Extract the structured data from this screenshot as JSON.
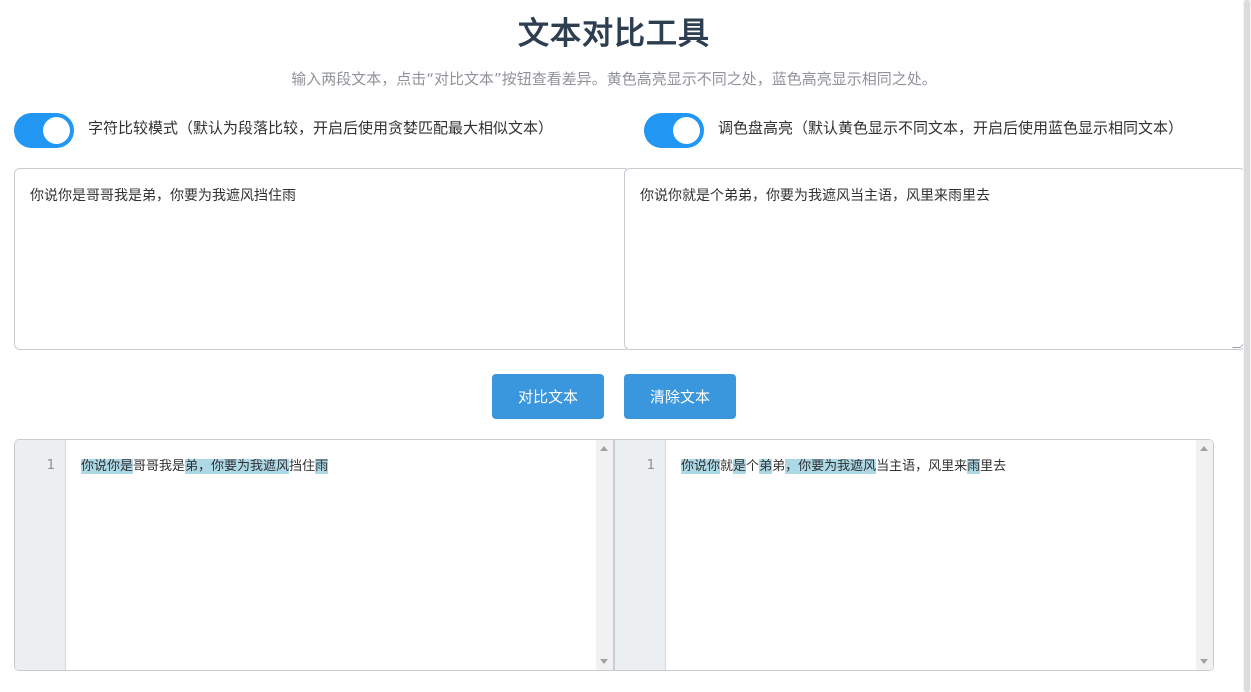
{
  "header": {
    "title": "文本对比工具",
    "subtitle": "输入两段文本，点击“对比文本”按钮查看差异。黄色高亮显示不同之处，蓝色高亮显示相同之处。"
  },
  "toggles": {
    "char_mode": {
      "label": "字符比较模式（默认为段落比较，开启后使用贪婪匹配最大相似文本）",
      "on": true
    },
    "palette": {
      "label": "调色盘高亮（默认黄色显示不同文本，开启后使用蓝色显示相同文本）",
      "on": true
    }
  },
  "inputs": {
    "left_text": "你说你是哥哥我是弟，你要为我遮风挡住雨",
    "right_text": "你说你就是个弟弟，你要为我遮风当主语，风里来雨里去"
  },
  "buttons": {
    "compare": "对比文本",
    "clear": "清除文本"
  },
  "diff": {
    "left": {
      "line_number": "1",
      "segments": [
        {
          "text": "你说你是",
          "same": true
        },
        {
          "text": "哥哥我是",
          "same": false
        },
        {
          "text": "弟，你要为我遮风",
          "same": true
        },
        {
          "text": "挡住",
          "same": false
        },
        {
          "text": "雨",
          "same": true
        }
      ]
    },
    "right": {
      "line_number": "1",
      "segments": [
        {
          "text": "你说你",
          "same": true
        },
        {
          "text": "就",
          "same": false
        },
        {
          "text": "是",
          "same": true
        },
        {
          "text": "个",
          "same": false
        },
        {
          "text": "弟",
          "same": true
        },
        {
          "text": "弟",
          "same": false
        },
        {
          "text": "，你要为我遮风",
          "same": true
        },
        {
          "text": "当主语，风里来",
          "same": false
        },
        {
          "text": "雨",
          "same": true
        },
        {
          "text": "里去",
          "same": false
        }
      ]
    },
    "colors": {
      "same_highlight": "#add8e6",
      "toggle_on": "#2196f3",
      "button": "#3a96dd"
    }
  }
}
